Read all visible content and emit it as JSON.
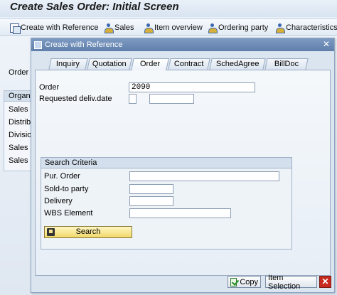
{
  "window": {
    "title": "Create Sales Order: Initial Screen"
  },
  "toolbar": {
    "items": [
      {
        "label": "Create with Reference",
        "icon": "reference-icon"
      },
      {
        "label": "Sales",
        "icon": "person-icon"
      },
      {
        "label": "Item overview",
        "icon": "person-icon"
      },
      {
        "label": "Ordering party",
        "icon": "person-icon"
      },
      {
        "label": "Characteristics",
        "icon": "person-icon"
      }
    ]
  },
  "background": {
    "order_label": "Order T",
    "org_header": "Organiz",
    "org_rows": [
      "Sales O",
      "Distribu",
      "Divisio",
      "Sales O",
      "Sales O"
    ]
  },
  "dialog": {
    "title": "Create with Reference",
    "tabs": [
      "Inquiry",
      "Quotation",
      "Order",
      "Contract",
      "SchedAgree",
      "BillDoc"
    ],
    "active_tab": "Order",
    "fields": {
      "order_label": "Order",
      "order_value": "2090",
      "deliv_date_label": "Requested deliv.date",
      "deliv_date_value": "",
      "deliv_date_value2": ""
    },
    "search": {
      "header": "Search Criteria",
      "fields": [
        {
          "label": "Pur. Order",
          "value": ""
        },
        {
          "label": "Sold-to party",
          "value": ""
        },
        {
          "label": "Delivery",
          "value": ""
        },
        {
          "label": "WBS Element",
          "value": ""
        }
      ],
      "button": "Search"
    },
    "footer": {
      "copy": "Copy",
      "item_selection": "Item Selection"
    }
  }
}
